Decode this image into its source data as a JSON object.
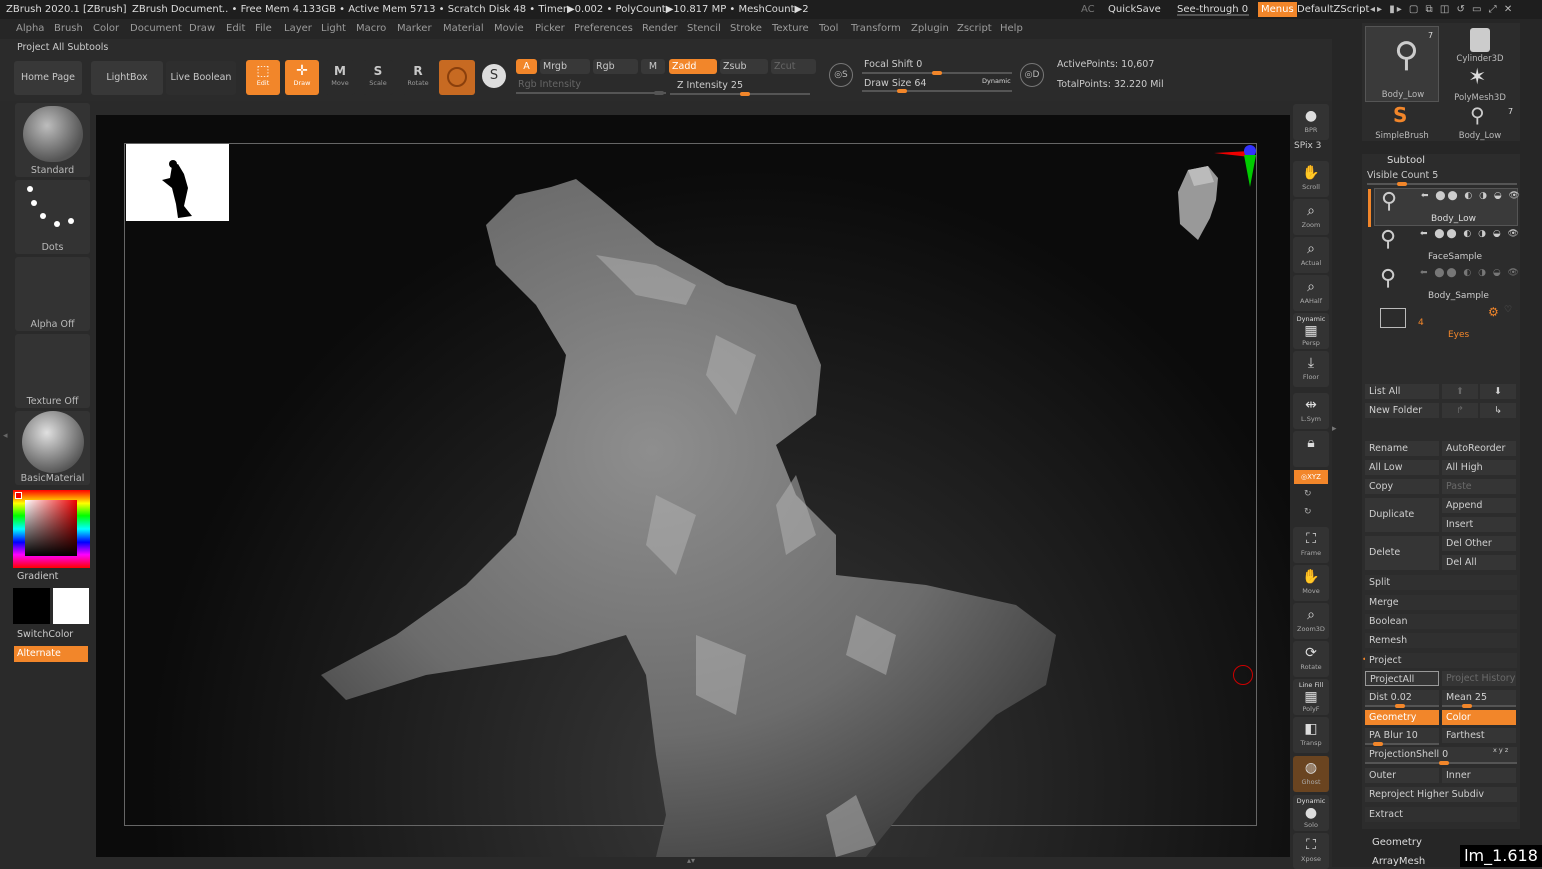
{
  "titlebar": {
    "app": "ZBrush 2020.1 [ZBrush]",
    "doc": "ZBrush Document",
    "stats": ".. • Free Mem 4.133GB • Active Mem 5713 • Scratch Disk 48 • Timer▶0.002 • PolyCount▶10.817 MP • MeshCount▶2",
    "ac": "AC",
    "quicksave": "QuickSave",
    "seethrough": "See-through 0",
    "menus": "Menus",
    "script": "DefaultZScript"
  },
  "menus": [
    "Alpha",
    "Brush",
    "Color",
    "Document",
    "Draw",
    "Edit",
    "File",
    "Layer",
    "Light",
    "Macro",
    "Marker",
    "Material",
    "Movie",
    "Picker",
    "Preferences",
    "Render",
    "Stencil",
    "Stroke",
    "Texture",
    "Tool",
    "Transform",
    "Zplugin",
    "Zscript",
    "Help"
  ],
  "shelf": {
    "label": "Project All Subtools",
    "home": "Home Page",
    "lightbox": "LightBox",
    "liveboolean": "Live Boolean",
    "tools": [
      {
        "label": "Edit",
        "icon": "edit-icon"
      },
      {
        "label": "Draw",
        "icon": "draw-icon"
      },
      {
        "label": "Move",
        "icon": "move-icon"
      },
      {
        "label": "Scale",
        "icon": "scale-icon"
      },
      {
        "label": "Rotate",
        "icon": "rotate-icon"
      }
    ],
    "a": "A",
    "mrgb": "Mrgb",
    "rgb": "Rgb",
    "m": "M",
    "rgb_intensity": "Rgb Intensity",
    "zadd": "Zadd",
    "zsub": "Zsub",
    "zcut": "Zcut",
    "z_intensity": "Z Intensity 25",
    "focal_shift": "Focal Shift 0",
    "draw_size": "Draw Size 64",
    "dynamic": "Dynamic",
    "active_points": "ActivePoints: 10,607",
    "total_points": "TotalPoints: 32.220 Mil"
  },
  "left": {
    "brush": "Standard",
    "stroke": "Dots",
    "alpha": "Alpha Off",
    "texture": "Texture Off",
    "material": "BasicMaterial",
    "gradient": "Gradient",
    "switchcolor": "SwitchColor",
    "alternate": "Alternate"
  },
  "rightshelf": [
    {
      "label": "BPR",
      "icon": "bpr-sphere-icon"
    },
    {
      "label": "SPix 3",
      "icon": ""
    },
    {
      "label": "Scroll",
      "icon": "scroll-icon"
    },
    {
      "label": "Zoom",
      "icon": "zoom-icon"
    },
    {
      "label": "Actual",
      "icon": "actual-icon"
    },
    {
      "label": "AAHalf",
      "icon": "aahalf-icon"
    },
    {
      "label": "Persp",
      "icon": "persp-icon"
    },
    {
      "label": "Floor",
      "icon": "floor-icon"
    },
    {
      "label": "L.Sym",
      "icon": "lsym-icon"
    },
    {
      "label": "",
      "icon": "lock-icon"
    },
    {
      "label": "XYZ",
      "icon": "xyz-icon"
    },
    {
      "label": "Frame",
      "icon": "frame-icon"
    },
    {
      "label": "Move",
      "icon": "move-icon"
    },
    {
      "label": "Zoom3D",
      "icon": "zoom3d-icon"
    },
    {
      "label": "Rotate",
      "icon": "rotate-icon"
    },
    {
      "label": "PolyF",
      "icon": "polyf-icon"
    },
    {
      "label": "Transp",
      "icon": "transp-icon"
    },
    {
      "label": "Ghost",
      "icon": "ghost-icon"
    },
    {
      "label": "Solo",
      "icon": "solo-icon"
    },
    {
      "label": "Xpose",
      "icon": "xpose-icon"
    }
  ],
  "shelf_misc": {
    "dynamic": "Dynamic",
    "line_fill": "Line Fill"
  },
  "tool_thumbs": [
    {
      "label": "Body_Low",
      "count": "7"
    },
    {
      "label": "Cylinder3D",
      "count": ""
    },
    {
      "label": "Body_Low",
      "count": ""
    },
    {
      "label": "PolyMesh3D",
      "count": ""
    },
    {
      "label": "SimpleBrush",
      "count": ""
    },
    {
      "label": "Body_Low",
      "count": "7"
    }
  ],
  "subtool": {
    "title": "Subtool",
    "visible_count": "Visible Count 5",
    "items": [
      {
        "name": "Body_Low"
      },
      {
        "name": "FaceSample"
      },
      {
        "name": "Body_Sample"
      }
    ],
    "folder": {
      "count": "4",
      "name": "Eyes"
    },
    "buttons": {
      "list_all": "List All",
      "new_folder": "New Folder",
      "rename": "Rename",
      "autoreorder": "AutoReorder",
      "all_low": "All Low",
      "all_high": "All High",
      "copy": "Copy",
      "paste": "Paste",
      "duplicate": "Duplicate",
      "append": "Append",
      "insert": "Insert",
      "delete": "Delete",
      "del_other": "Del Other",
      "del_all": "Del All",
      "split": "Split",
      "merge": "Merge",
      "boolean": "Boolean",
      "remesh": "Remesh",
      "project": "Project",
      "projectall": "ProjectAll",
      "project_history": "Project History",
      "dist": "Dist 0.02",
      "mean": "Mean 25",
      "geometry": "Geometry",
      "color": "Color",
      "pa_blur": "PA Blur 10",
      "farthest": "Farthest",
      "projection_shell": "ProjectionShell 0",
      "xyz": "x y z",
      "outer": "Outer",
      "inner": "Inner",
      "reproject": "Reproject Higher Subdiv",
      "extract": "Extract"
    },
    "footer": [
      "Geometry",
      "ArrayMesh"
    ]
  },
  "watermark": "lm_1.618",
  "colors": {
    "accent": "#f2862a",
    "bg": "#2a2a2a",
    "canvas": "#0d0d0d"
  }
}
